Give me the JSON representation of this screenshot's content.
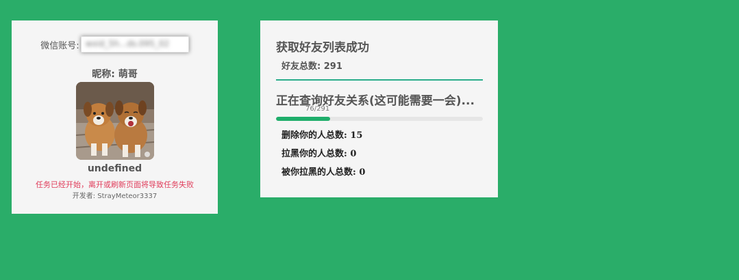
{
  "left_card": {
    "account_label": "微信账号:",
    "account_value": "wxid_5h...ds.095_02",
    "nickname": "昵称: 萌哥",
    "avatar_icon": "dogs-photo-avatar",
    "status_name": "undefined",
    "warning": "任务已经开始，离开或刷新页面将导致任务失败",
    "developer": "开发者: StrayMeteor3337"
  },
  "right_card": {
    "title": "获取好友列表成功",
    "total_friends": "好友总数: 291",
    "query_title": "正在查询好友关系(这可能需要一会)...",
    "progress_text": "76/291",
    "progress_fraction": 0.261,
    "deleted_you": "删除你的人总数: 15",
    "blocked_you": "拉黑你的人总数: 0",
    "blocked_by_you": "被你拉黑的人总数: 0"
  },
  "colors": {
    "background": "#2aad69",
    "card": "#f5f5f5",
    "accent": "#2aad8a",
    "warning": "#e03c5a"
  }
}
